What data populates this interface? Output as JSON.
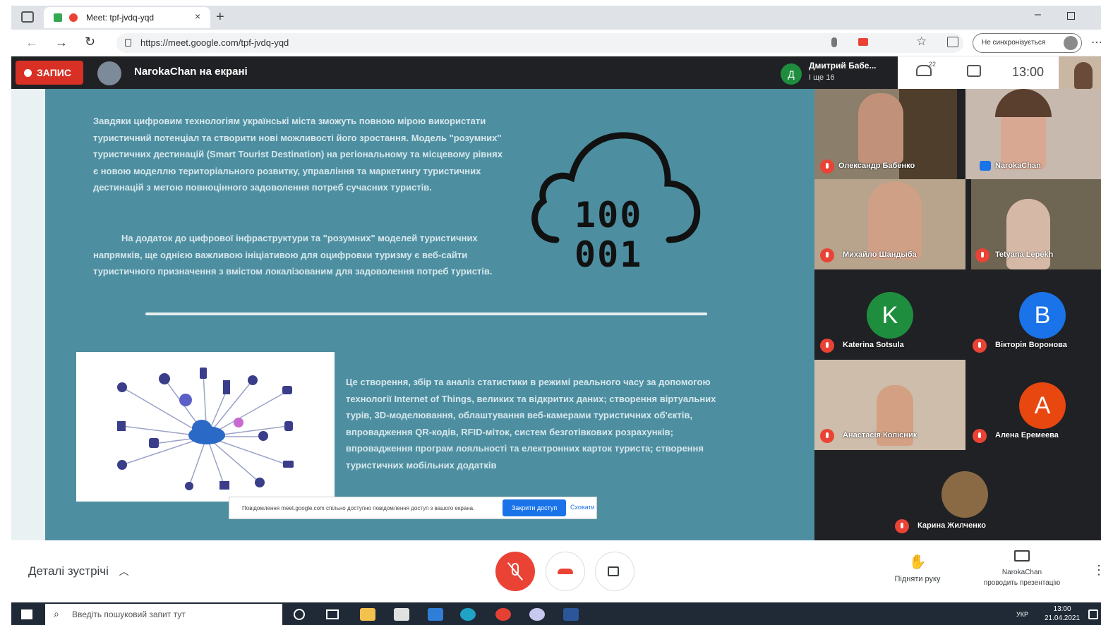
{
  "browser": {
    "tab_title": "Meet: tpf-jvdq-yqd",
    "url": "https://meet.google.com/tpf-jvdq-yqd",
    "profile_label": "Не синхронізується"
  },
  "meet": {
    "recording_label": "ЗАПИС",
    "presenting_text": "NarokaChan на екрані",
    "speaker_initial": "Д",
    "speaker_name": "Дмитрий Бабе...",
    "speaker_sub": "І ще 16",
    "people_count": "22",
    "clock": "13:00"
  },
  "slide": {
    "para1": "Завдяки цифровим технологіям українські міста зможуть повною мірою використати туристичний потенціал та створити нові можливості його зростання. Модель \"розумних\" туристичних дестинацій (Smart Tourist Destination) на регіональному та місцевому рівнях є новою моделлю територіального розвитку, управління та маркетингу туристичних дестинацій з метою повноцінного задоволення потреб сучасних туристів.",
    "para2": "На додаток до цифрової інфраструктури та \"розумних\" моделей туристичних напрямків, ще однією важливою ініціативою для оцифровки туризму є веб-сайти туристичного призначення з вмістом локалізованим для задоволення потреб туристів.",
    "para3": "Це створення, збір та аналіз статистики в режимі реального часу за допомогою технології Internet of Things, великих та відкритих даних; створення віртуальних турів, 3D-моделювання, облаштування веб-камерами туристичних об'єктів, впровадження QR-кодів, RFID-міток, систем безготівкових розрахунків; впровадження програм лояльності та електронних карток туриста; створення туристичних мобільних додатків",
    "cloud_top": "100",
    "cloud_bottom": "001",
    "notice_text": "Повідомлення meet.google.com спільно доступно повідомлення доступ з вашого екрана.",
    "notice_button": "Закрити доступ",
    "notice_hide": "Сховати"
  },
  "participants": [
    {
      "name": "Олександр Бабенко"
    },
    {
      "name": "NarokaChan"
    },
    {
      "name": "Михайло Шандыба"
    },
    {
      "name": "Tetyana Lepekh"
    },
    {
      "name": "Katerina Sotsula",
      "initial": "K",
      "color": "#1e8e3e"
    },
    {
      "name": "Вікторія Воронова",
      "initial": "В",
      "color": "#1a73e8"
    },
    {
      "name": "Анастасія Колісник"
    },
    {
      "name": "Алена Еремеева",
      "initial": "А",
      "color": "#e8470f"
    },
    {
      "name": "Карина Жилченко"
    }
  ],
  "bottom": {
    "details_label": "Деталі зустрічі",
    "raise_hand": "Підняти руку",
    "presenter_line1": "NarokaChan",
    "presenter_line2": "проводить презентацію"
  },
  "taskbar": {
    "search_placeholder": "Введіть пошуковий запит тут",
    "time": "13:00",
    "date": "21.04.2021",
    "lang": "УКР"
  }
}
